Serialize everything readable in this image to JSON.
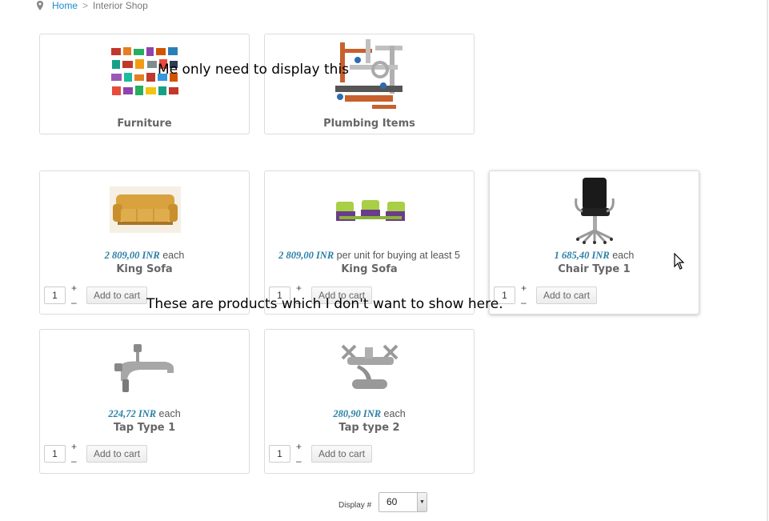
{
  "breadcrumb": {
    "home": "Home",
    "separator": ">",
    "current": "Interior Shop"
  },
  "categories": [
    {
      "label": "Furniture"
    },
    {
      "label": "Plumbing Items"
    }
  ],
  "products": [
    {
      "price": "2 809,00 INR",
      "unit": "each",
      "name": "King Sofa",
      "qty": "1",
      "plus": "+",
      "minus": "–",
      "cart": "Add to cart"
    },
    {
      "price": "2 809,00 INR",
      "unit": "per unit for buying at least 5",
      "name": "King Sofa",
      "qty": "1",
      "plus": "+",
      "minus": "–",
      "cart": "Add to cart"
    },
    {
      "price": "1 685,40 INR",
      "unit": "each",
      "name": "Chair Type 1",
      "qty": "1",
      "plus": "+",
      "minus": "–",
      "cart": "Add to cart"
    },
    {
      "price": "224,72 INR",
      "unit": "each",
      "name": "Tap Type 1",
      "qty": "1",
      "plus": "+",
      "minus": "–",
      "cart": "Add to cart"
    },
    {
      "price": "280,90 INR",
      "unit": "each",
      "name": "Tap type 2",
      "qty": "1",
      "plus": "+",
      "minus": "–",
      "cart": "Add to cart"
    }
  ],
  "annotations": {
    "top": "Me only need to display this",
    "middle": "These are products which I don't want to show here."
  },
  "pagination": {
    "label": "Display #",
    "selected": "60"
  },
  "colors": {
    "link": "#1a8bc9",
    "price": "#2a7fa5",
    "border": "#dcdcdc"
  }
}
